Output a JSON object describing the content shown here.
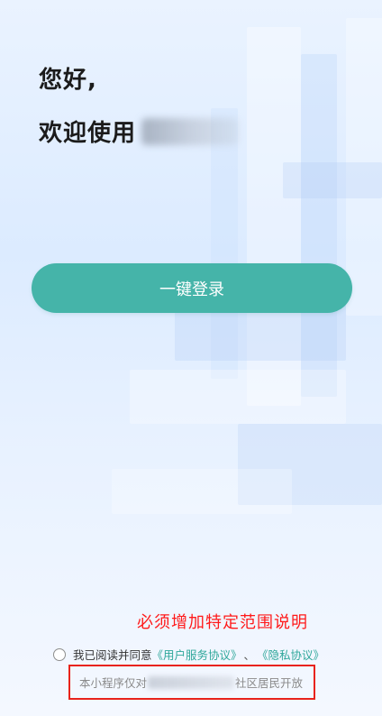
{
  "greeting": {
    "line1": "您好,",
    "line2_prefix": "欢迎使用"
  },
  "login_button": {
    "label": "一键登录"
  },
  "notice": {
    "text": "必须增加特定范围说明"
  },
  "agreement": {
    "prefix": "我已阅读并同意",
    "user_agreement": "《用户服务协议》",
    "separator": "、",
    "privacy_agreement": "《隐私协议》"
  },
  "scope": {
    "prefix": "本小程序仅对",
    "suffix": "社区居民开放"
  },
  "colors": {
    "accent": "#45b4a9",
    "link": "#2fa79a",
    "notice": "#ff1a1a",
    "highlight_border": "#e8231b"
  }
}
